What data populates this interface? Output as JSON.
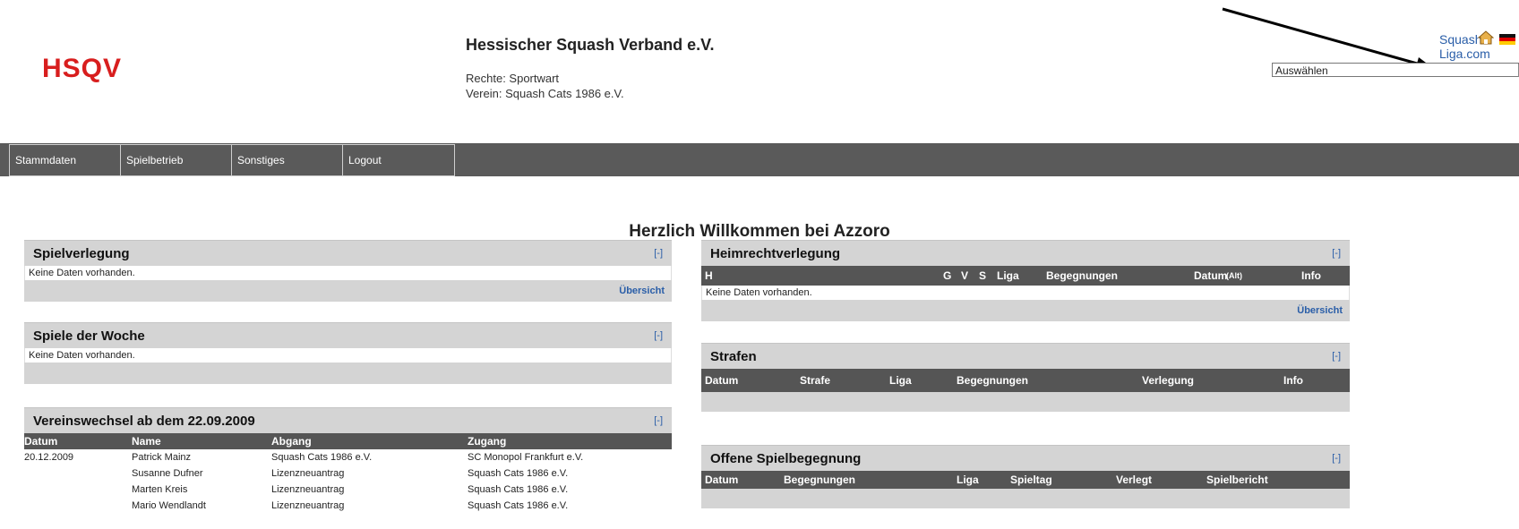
{
  "header": {
    "logo": "HSQV",
    "org_title": "Hessischer Squash Verband e.V.",
    "rights": "Rechte: Sportwart",
    "club": "Verein: Squash Cats 1986 e.V.",
    "top_link": "Squash-Liga.com",
    "select_value": "Auswählen"
  },
  "nav": [
    "Stammdaten",
    "Spielbetrieb",
    "Sonstiges",
    "Logout"
  ],
  "welcome": "Herzlich Willkommen bei Azzoro",
  "spielverlegung": {
    "title": "Spielverlegung",
    "toggle": "[-]",
    "empty": "Keine Daten vorhanden.",
    "footer_link": "Übersicht"
  },
  "spiele_woche": {
    "title": "Spiele der Woche",
    "toggle": "[-]",
    "empty": "Keine Daten vorhanden."
  },
  "vereinswechsel": {
    "title": "Vereinswechsel ab dem 22.09.2009",
    "toggle": "[-]",
    "columns": [
      "Datum",
      "Name",
      "Abgang",
      "Zugang"
    ],
    "rows": [
      [
        "20.12.2009",
        "Patrick Mainz",
        "Squash Cats 1986 e.V.",
        "SC Monopol Frankfurt e.V."
      ],
      [
        "",
        "Susanne Dufner",
        "Lizenzneuantrag",
        "Squash Cats 1986 e.V."
      ],
      [
        "",
        "Marten Kreis",
        "Lizenzneuantrag",
        "Squash Cats 1986 e.V."
      ],
      [
        "",
        "Mario Wendlandt",
        "Lizenzneuantrag",
        "Squash Cats 1986 e.V."
      ]
    ]
  },
  "heimrecht": {
    "title": "Heimrechtverlegung",
    "toggle": "[-]",
    "columns": [
      "H",
      "G",
      "V",
      "S",
      "Liga",
      "Begegnungen",
      "Datum",
      "(Alt)",
      "Info"
    ],
    "empty": "Keine Daten vorhanden.",
    "footer_link": "Übersicht"
  },
  "strafen": {
    "title": "Strafen",
    "toggle": "[-]",
    "columns": [
      "Datum",
      "Strafe",
      "Liga",
      "Begegnungen",
      "Verlegung",
      "Info"
    ]
  },
  "offene": {
    "title": "Offene Spielbegegnung",
    "toggle": "[-]",
    "columns": [
      "Datum",
      "Begegnungen",
      "Liga",
      "Spieltag",
      "Verlegt",
      "Spielbericht"
    ]
  },
  "colors": {
    "logo": "#d81e1e",
    "nav": "#5a5a5a",
    "panel_head": "#d4d4d4",
    "table_head": "#555555",
    "link": "#2a5ea8"
  },
  "icons": [
    "home-icon",
    "flag-de-icon",
    "dropdown-caret-icon"
  ]
}
